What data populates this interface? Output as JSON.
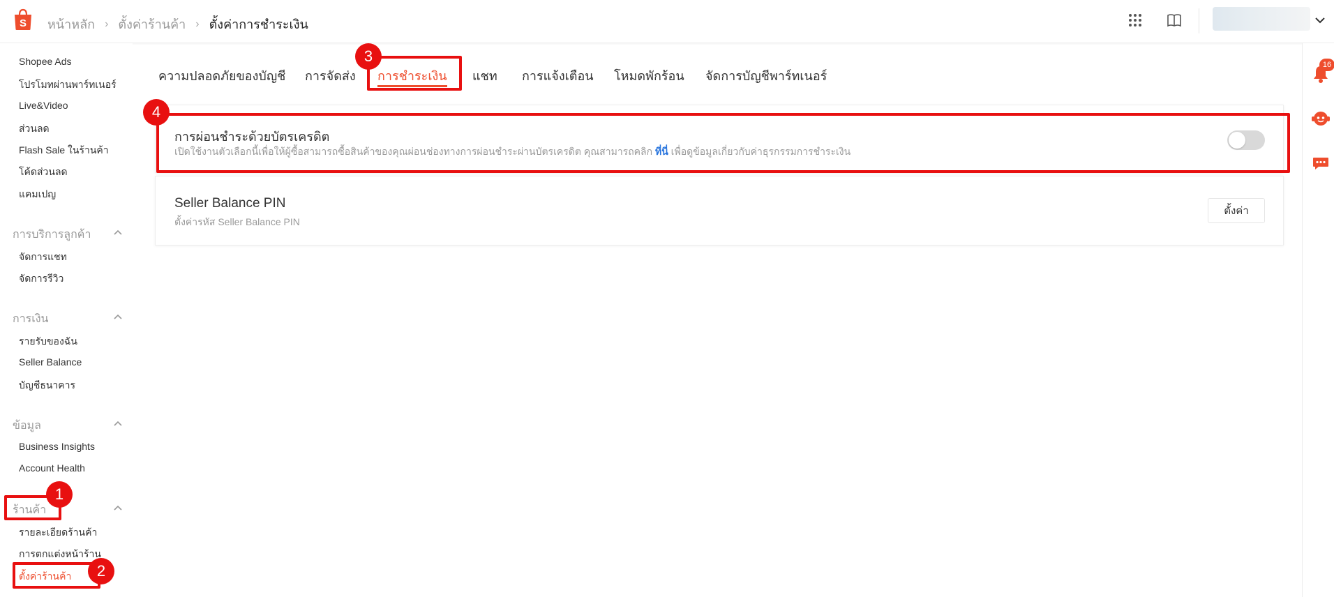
{
  "header": {
    "breadcrumb": [
      "หน้าหลัก",
      "ตั้งค่าร้านค้า",
      "ตั้งค่าการชำระเงิน"
    ],
    "icons": [
      "apps-grid-icon",
      "book-icon"
    ],
    "user_caret": "chevron-down-icon"
  },
  "sidebar": {
    "items_top": [
      "Shopee Ads",
      "โปรโมทผ่านพาร์ทเนอร์",
      "Live&Video",
      "ส่วนลด",
      "Flash Sale ในร้านค้า",
      "โค้ดส่วนลด",
      "แคมเปญ"
    ],
    "groups": [
      {
        "label": "การบริการลูกค้า",
        "items": [
          "จัดการแชท",
          "จัดการรีวิว"
        ]
      },
      {
        "label": "การเงิน",
        "items": [
          "รายรับของฉัน",
          "Seller Balance",
          "บัญชีธนาคาร"
        ]
      },
      {
        "label": "ข้อมูล",
        "items": [
          "Business Insights",
          "Account Health"
        ]
      },
      {
        "label": "ร้านค้า",
        "items": [
          "รายละเอียดร้านค้า",
          "การตกแต่งหน้าร้าน",
          "ตั้งค่าร้านค้า"
        ]
      }
    ],
    "active_item": "ตั้งค่าร้านค้า"
  },
  "tabs": [
    "ความปลอดภัยของบัญชี",
    "การจัดส่ง",
    "การชำระเงิน",
    "แชท",
    "การแจ้งเตือน",
    "โหมดพักร้อน",
    "จัดการบัญชีพาร์ทเนอร์"
  ],
  "active_tab": "การชำระเงิน",
  "installment": {
    "title": "การผ่อนชำระด้วยบัตรเครดิต",
    "desc_before": "เปิดใช้งานตัวเลือกนี้เพื่อให้ผู้ซื้อสามารถซื้อสินค้าของคุณผ่อนช่องทางการผ่อนชำระผ่านบัตรเครดิต คุณสามารถคลิก ",
    "desc_link": "ที่นี่",
    "desc_after": " เพื่อดูข้อมูลเกี่ยวกับค่าธุรกรรมการชำระเงิน",
    "toggle_on": false
  },
  "seller_pin": {
    "title": "Seller Balance PIN",
    "desc": "ตั้งค่ารหัส Seller Balance PIN",
    "button": "ตั้งค่า"
  },
  "markers": [
    "1",
    "2",
    "3",
    "4"
  ],
  "right_rail": {
    "notification_count": "16",
    "icons": [
      "bell-icon",
      "support-bot-icon",
      "chat-icon"
    ]
  },
  "colors": {
    "accent": "#ee4d2d",
    "marker": "#e81010",
    "link": "#2673dd"
  }
}
